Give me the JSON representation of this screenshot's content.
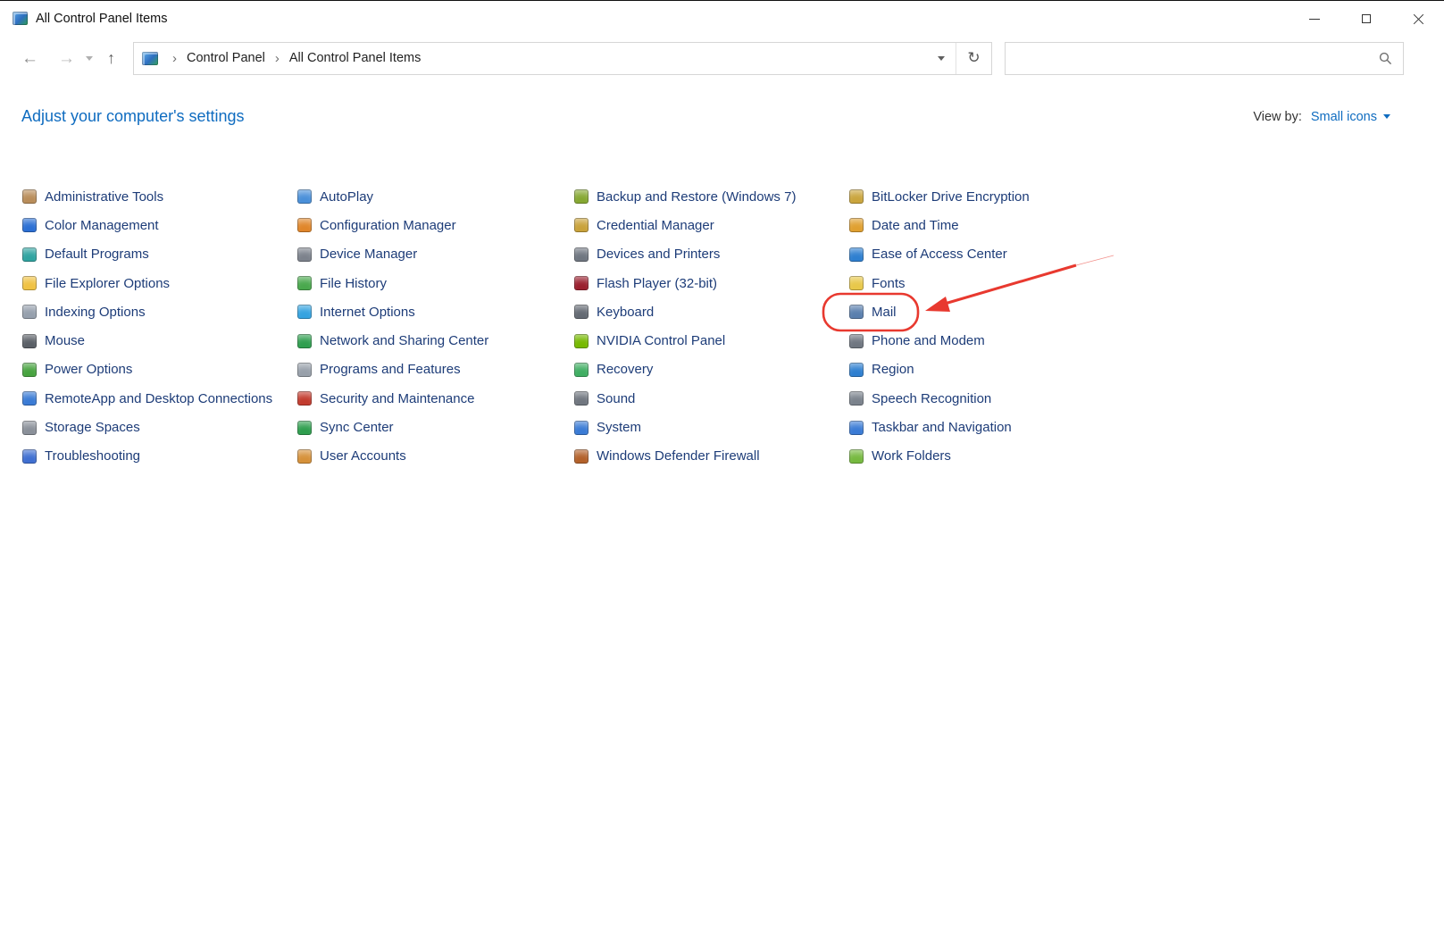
{
  "window": {
    "title": "All Control Panel Items"
  },
  "navigation": {
    "icons": {
      "back": "←",
      "forward": "→",
      "up": "↑",
      "refresh": "↻"
    },
    "breadcrumb": {
      "separator": "›",
      "items": [
        "Control Panel",
        "All Control Panel Items"
      ]
    }
  },
  "search": {
    "value": "",
    "placeholder": ""
  },
  "header": {
    "title": "Adjust your computer's settings",
    "view_by_label": "View by:",
    "view_by_value": "Small icons"
  },
  "items": {
    "columns": [
      {
        "entries": [
          {
            "label": "Administrative Tools",
            "icon": "administrative-tools",
            "color": "#b98d5a"
          },
          {
            "label": "Color Management",
            "icon": "color-management",
            "color": "#2b6fd4"
          },
          {
            "label": "Default Programs",
            "icon": "default-programs",
            "color": "#2fa3a0"
          },
          {
            "label": "File Explorer Options",
            "icon": "file-explorer-options",
            "color": "#f0c243"
          },
          {
            "label": "Indexing Options",
            "icon": "indexing-options",
            "color": "#96a0ad"
          },
          {
            "label": "Mouse",
            "icon": "mouse",
            "color": "#5a5f66"
          },
          {
            "label": "Power Options",
            "icon": "power-options",
            "color": "#47a33f"
          },
          {
            "label": "RemoteApp and Desktop Connections",
            "icon": "remoteapp-desktop-connections",
            "color": "#3a7bd5"
          },
          {
            "label": "Storage Spaces",
            "icon": "storage-spaces",
            "color": "#8a9099"
          },
          {
            "label": "Troubleshooting",
            "icon": "troubleshooting",
            "color": "#3f6fd1"
          }
        ]
      },
      {
        "entries": [
          {
            "label": "AutoPlay",
            "icon": "autoplay",
            "color": "#4a90d9"
          },
          {
            "label": "Configuration Manager",
            "icon": "configuration-manager",
            "color": "#e0862a"
          },
          {
            "label": "Device Manager",
            "icon": "device-manager",
            "color": "#7c828c"
          },
          {
            "label": "File History",
            "icon": "file-history",
            "color": "#49a84d"
          },
          {
            "label": "Internet Options",
            "icon": "internet-options",
            "color": "#35a3e0"
          },
          {
            "label": "Network and Sharing Center",
            "icon": "network-sharing-center",
            "color": "#2f9e4f"
          },
          {
            "label": "Programs and Features",
            "icon": "programs-and-features",
            "color": "#98a0aa"
          },
          {
            "label": "Security and Maintenance",
            "icon": "security-maintenance",
            "color": "#c23b2e"
          },
          {
            "label": "Sync Center",
            "icon": "sync-center",
            "color": "#2e9e4e"
          },
          {
            "label": "User Accounts",
            "icon": "user-accounts",
            "color": "#d6913a"
          }
        ]
      },
      {
        "entries": [
          {
            "label": "Backup and Restore (Windows 7)",
            "icon": "backup-and-restore",
            "color": "#86a832"
          },
          {
            "label": "Credential Manager",
            "icon": "credential-manager",
            "color": "#c9a23a"
          },
          {
            "label": "Devices and Printers",
            "icon": "devices-and-printers",
            "color": "#6f7680"
          },
          {
            "label": "Flash Player (32-bit)",
            "icon": "flash-player",
            "color": "#9a1f2e"
          },
          {
            "label": "Keyboard",
            "icon": "keyboard",
            "color": "#646a73"
          },
          {
            "label": "NVIDIA Control Panel",
            "icon": "nvidia-control-panel",
            "color": "#76b900"
          },
          {
            "label": "Recovery",
            "icon": "recovery",
            "color": "#3fae62"
          },
          {
            "label": "Sound",
            "icon": "sound",
            "color": "#70767f"
          },
          {
            "label": "System",
            "icon": "system",
            "color": "#3a7bd5"
          },
          {
            "label": "Windows Defender Firewall",
            "icon": "windows-defender-firewall",
            "color": "#b3612a"
          }
        ]
      },
      {
        "entries": [
          {
            "label": "BitLocker Drive Encryption",
            "icon": "bitlocker-drive-encryption",
            "color": "#caa53d"
          },
          {
            "label": "Date and Time",
            "icon": "date-and-time",
            "color": "#e0a030"
          },
          {
            "label": "Ease of Access Center",
            "icon": "ease-of-access-center",
            "color": "#2e7fd0"
          },
          {
            "label": "Fonts",
            "icon": "fonts",
            "color": "#e8c84a"
          },
          {
            "label": "Mail",
            "icon": "mail",
            "color": "#5a7fae",
            "highlight": true
          },
          {
            "label": "Phone and Modem",
            "icon": "phone-and-modem",
            "color": "#6f7680"
          },
          {
            "label": "Region",
            "icon": "region",
            "color": "#2e7fd0"
          },
          {
            "label": "Speech Recognition",
            "icon": "speech-recognition",
            "color": "#7a828c"
          },
          {
            "label": "Taskbar and Navigation",
            "icon": "taskbar-and-navigation",
            "color": "#3a7bd5"
          },
          {
            "label": "Work Folders",
            "icon": "work-folders",
            "color": "#76b93f"
          }
        ]
      }
    ]
  },
  "annotation": {
    "color": "#e8392f",
    "highlighted_item": "Mail"
  }
}
